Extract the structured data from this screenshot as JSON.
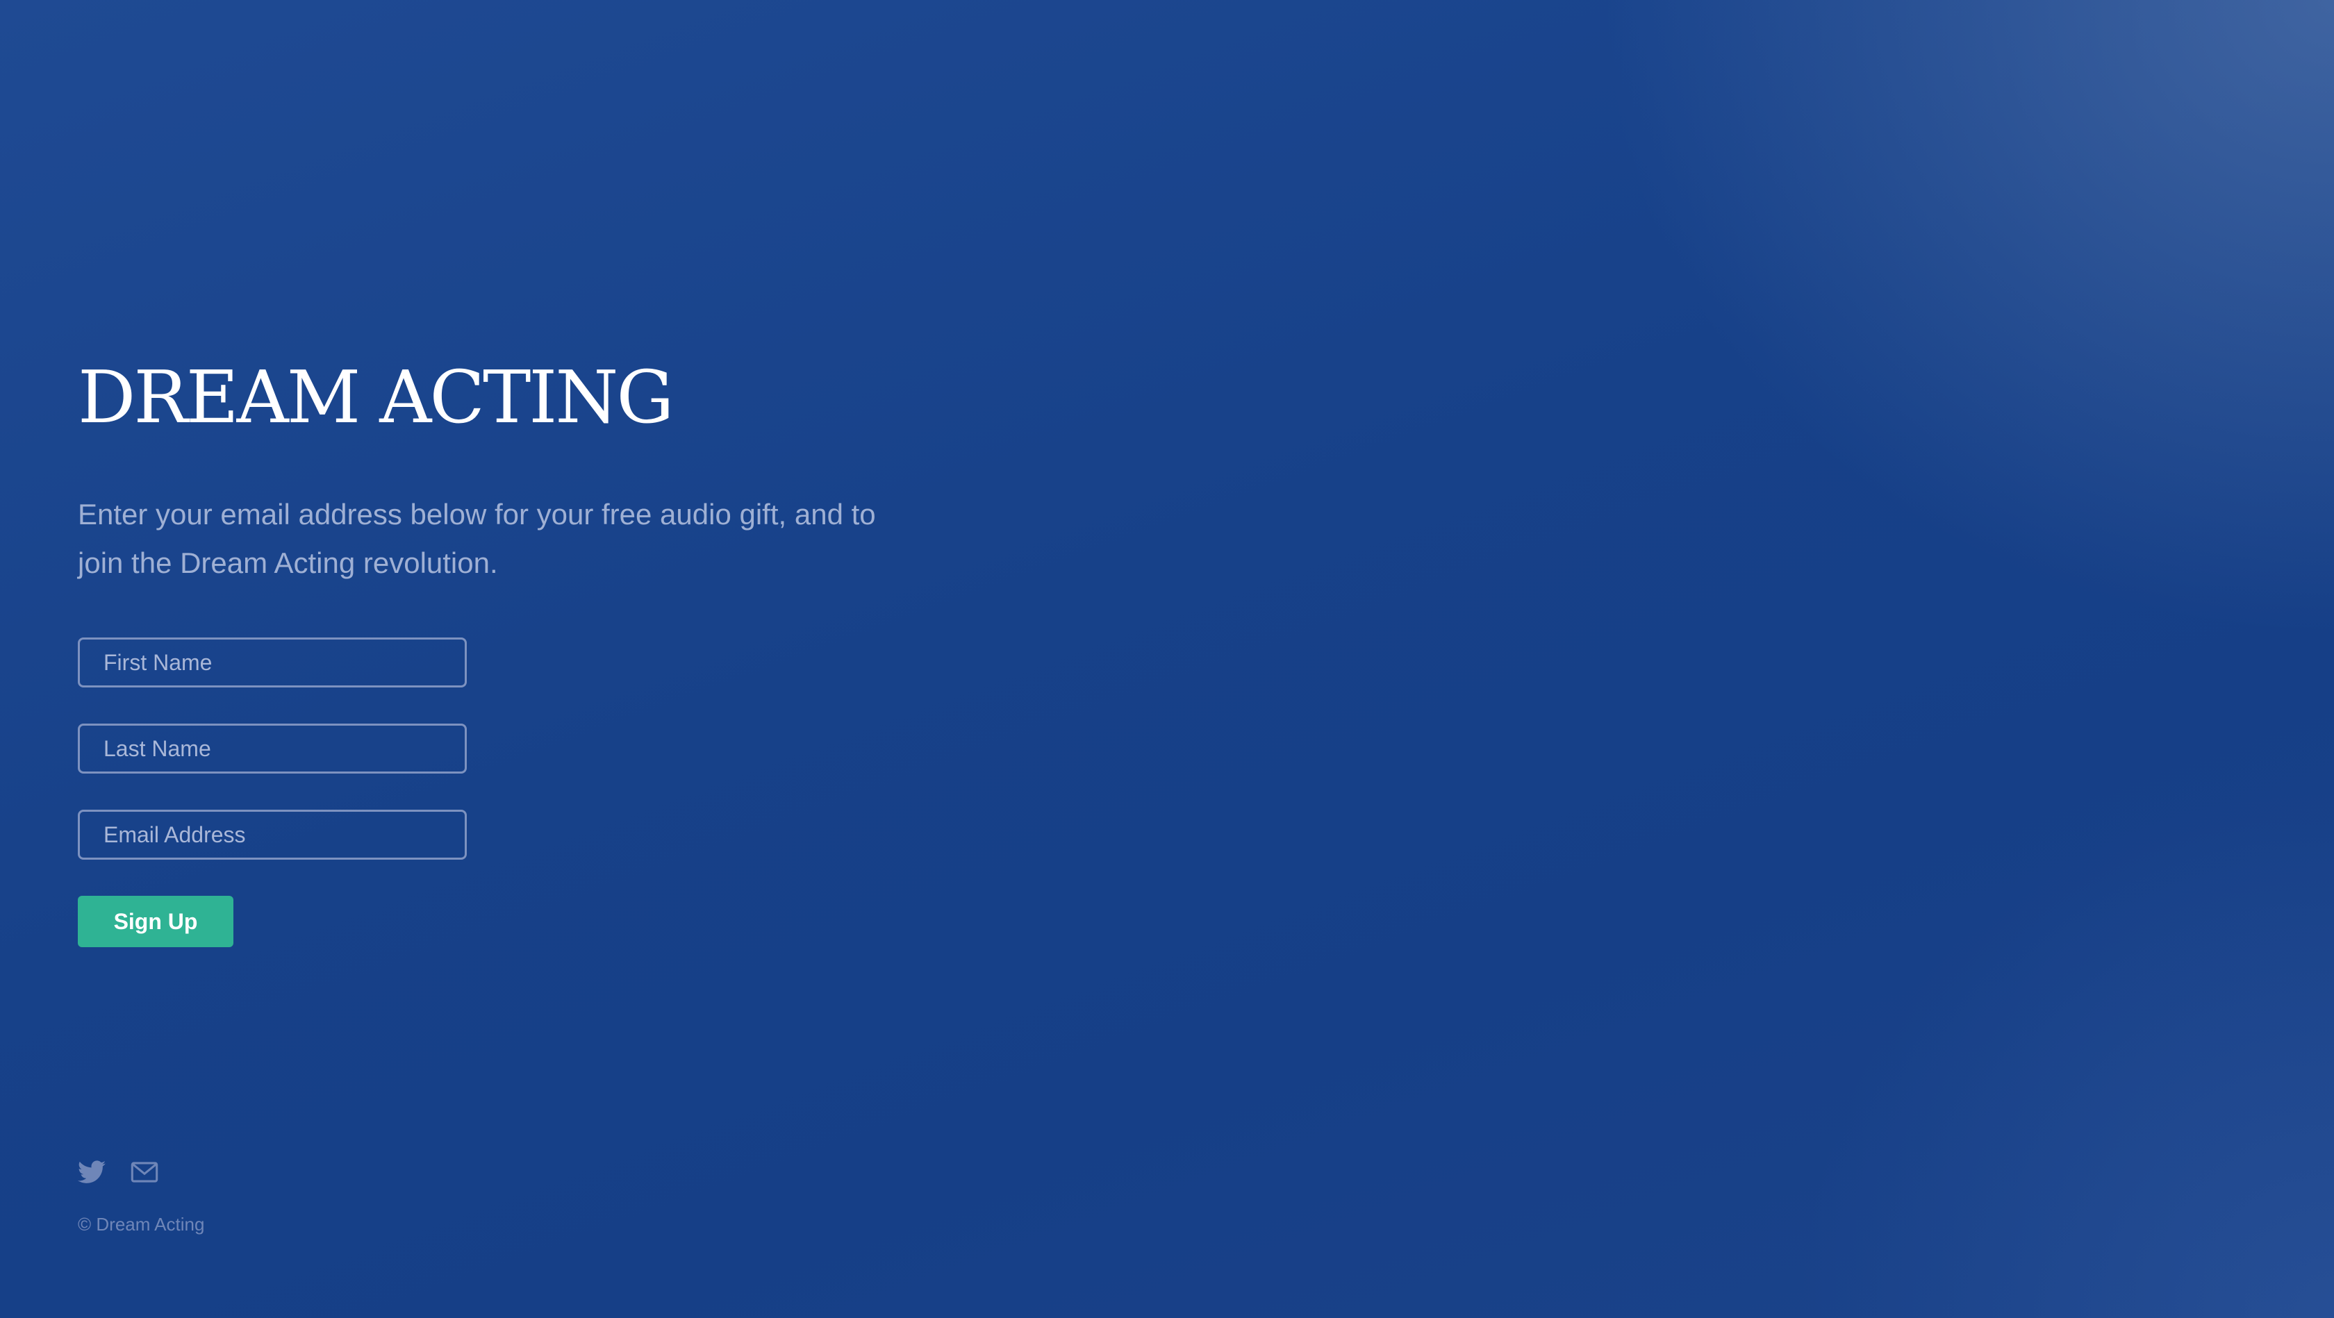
{
  "brand": {
    "title": "DREAM ACTING"
  },
  "intro": {
    "text": "Enter your email address below for your free audio gift, and to join the Dream Acting revolution."
  },
  "form": {
    "first_name_placeholder": "First Name",
    "last_name_placeholder": "Last Name",
    "email_placeholder": "Email Address",
    "submit_label": "Sign Up"
  },
  "footer": {
    "icons": [
      "twitter-icon",
      "mail-icon"
    ],
    "copyright": "© Dream Acting"
  },
  "colors": {
    "background": "#174189",
    "accent": "#2fb394",
    "text_muted": "#9fb0d4"
  }
}
